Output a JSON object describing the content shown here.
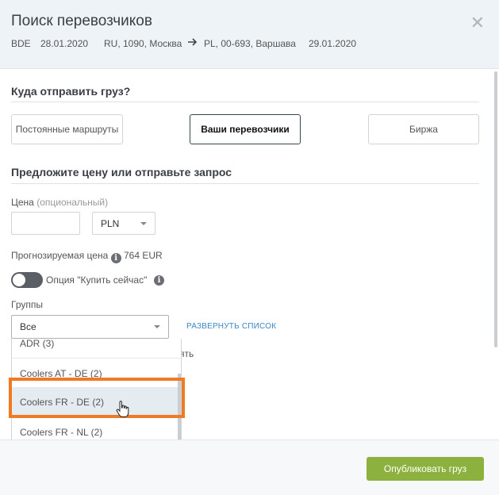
{
  "dialog": {
    "title": "Поиск перевозчиков",
    "meta": {
      "code": "BDE",
      "load_date": "28.01.2020",
      "from": "RU, 1090, Москва",
      "to": "PL, 00-693, Варшава",
      "unload_date": "29.01.2020"
    }
  },
  "send_section": {
    "heading": "Куда отправить груз?",
    "buttons": [
      "Постоянные маршруты",
      "Ваши перевозчики",
      "Биржа"
    ],
    "active_index": 1
  },
  "price_section": {
    "heading": "Предложите цену или отправьте запрос",
    "price_label": "Цена",
    "price_optional": "(опциональный)",
    "price_value": "",
    "currency": "PLN",
    "forecast_label": "Прогнозируемая цена",
    "forecast_value": "764 EUR",
    "buy_now_label": "Опция \"Купить сейчас\"",
    "buy_now_enabled": false
  },
  "groups": {
    "label": "Группы",
    "selected": "Все",
    "expand_link": "РАЗВЕРНУТЬ СПИСОК",
    "obscured_text": "ять",
    "options": [
      "ADR (3)",
      "Coolers AT - DE (2)",
      "Coolers FR - DE (2)",
      "Coolers FR - NL (2)"
    ],
    "hovered_index": 2
  },
  "footer": {
    "publish_label": "Опубликовать груз"
  },
  "colors": {
    "accent_green": "#8db13e",
    "highlight_orange": "#f07a22",
    "link_blue": "#3a87c8"
  }
}
